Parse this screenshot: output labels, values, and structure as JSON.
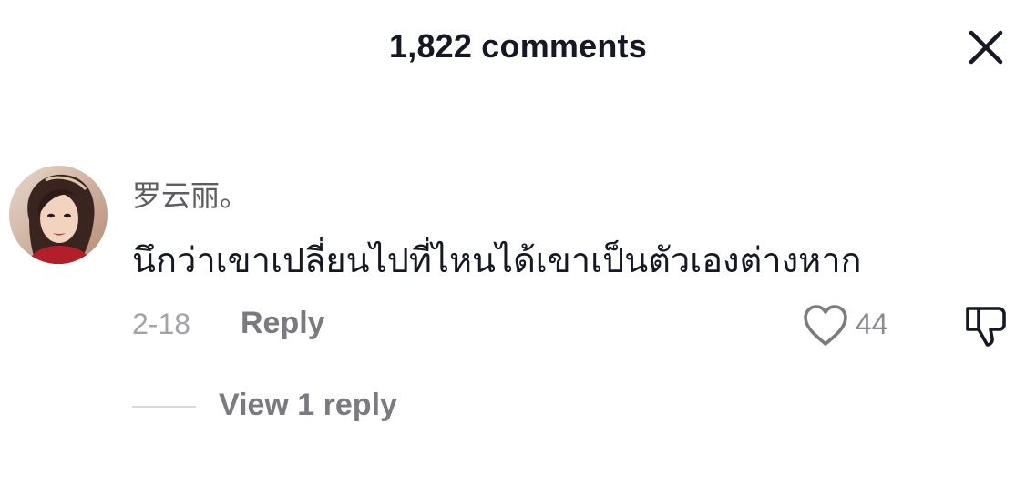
{
  "header": {
    "title": "1,822 comments",
    "close_icon": "close-icon"
  },
  "comment": {
    "username": "罗云丽。",
    "text": "นึกว่าเขาเปลี่ยนไปที่ไหนได้เขาเป็นตัวเองต่างหาก",
    "date": "2-18",
    "reply_label": "Reply",
    "like_icon": "heart-outline-icon",
    "like_count": "44",
    "dislike_icon": "thumbs-down-icon",
    "view_replies_label": "View 1 reply"
  },
  "colors": {
    "primary_text": "#161823",
    "secondary_text": "#7a7a80",
    "muted_text": "#a3a3a8",
    "divider": "#d9d9dc",
    "background": "#ffffff"
  }
}
